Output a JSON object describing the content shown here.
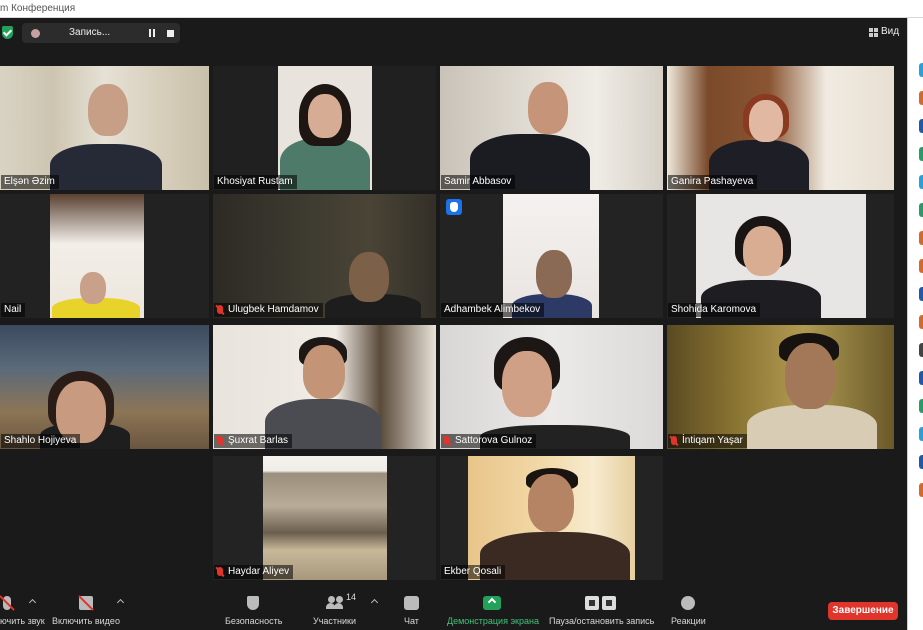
{
  "window": {
    "title": "m Конференция"
  },
  "topbar": {
    "recording_label": "Запись...",
    "view_label": "Вид"
  },
  "participants": [
    {
      "name": "Elşən Əzim",
      "muted": false
    },
    {
      "name": "Khosiyat Rustam",
      "muted": false
    },
    {
      "name": "Samir Abbasov",
      "muted": false
    },
    {
      "name": "Ganira Pashayeva",
      "muted": false,
      "active_speaker": true
    },
    {
      "name": "Nail",
      "muted": false
    },
    {
      "name": "Ulugbek Hamdamov",
      "muted": true
    },
    {
      "name": "Adhambek Alimbekov",
      "muted": false,
      "hand_raised": true
    },
    {
      "name": "Shohida Karomova",
      "muted": false
    },
    {
      "name": "Shahlo Hojiyeva",
      "muted": false
    },
    {
      "name": "Şuxrat Barlas",
      "muted": true
    },
    {
      "name": "Sattorova Gulnoz",
      "muted": true
    },
    {
      "name": "İntiqam Yaşar",
      "muted": true
    },
    {
      "name": "Haydar Aliyev",
      "muted": true
    },
    {
      "name": "Ekber Qosali",
      "muted": false
    }
  ],
  "toolbar": {
    "unmute_label": "ючить звук",
    "video_label": "Включить видео",
    "security_label": "Безопасность",
    "participants_label": "Участники",
    "participants_count": "14",
    "chat_label": "Чат",
    "share_label": "Демонстрация экрана",
    "record_label": "Пауза/остановить запись",
    "reactions_label": "Реакции",
    "end_label": "Завершение"
  },
  "colors": {
    "accent_green": "#23a15a",
    "end_red": "#e0352b",
    "active_speaker": "#d5dd3b",
    "background": "#1a1a1a"
  },
  "icons": [
    "shield-icon",
    "pause-icon",
    "stop-icon",
    "grid-icon",
    "mic-muted-icon",
    "raised-hand-icon",
    "camera-off-icon",
    "security-icon",
    "participants-icon",
    "chat-icon",
    "share-screen-icon",
    "record-pause-icon",
    "reactions-icon"
  ]
}
